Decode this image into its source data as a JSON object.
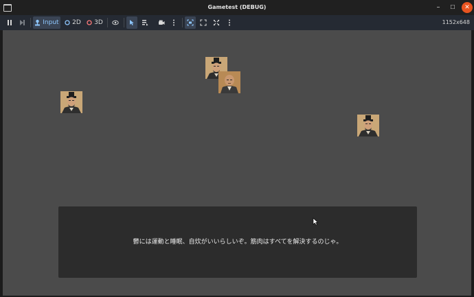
{
  "window": {
    "title": "Gametest (DEBUG)"
  },
  "toolbar": {
    "input_label": "Input",
    "mode_2d_label": "2D",
    "mode_3d_label": "3D",
    "resolution": "1152x648"
  },
  "dialog": {
    "text": "鬱には運動と睡眠、自炊がいいらしいぞ。筋肉はすべてを解決するのじゃ。"
  },
  "colors": {
    "accent": "#8ec7ff",
    "close": "#e95420",
    "viewport": "#4b4b4b",
    "dialog": "#2c2c2c"
  }
}
